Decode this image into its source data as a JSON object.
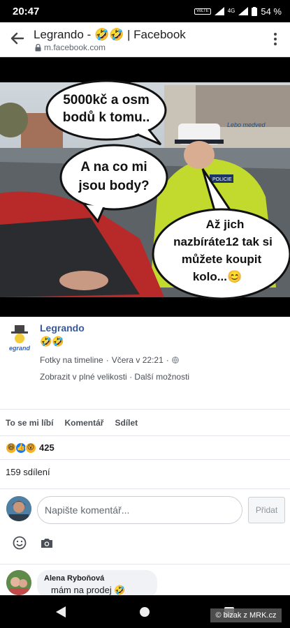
{
  "status": {
    "time": "20:47",
    "volte": "VoLTE",
    "network": "4G",
    "battery": "54 %"
  },
  "browser": {
    "title": "Legrando - 🤣🤣 | Facebook",
    "host": "m.facebook.com",
    "icons": {
      "back": "arrow-left-icon",
      "lock": "lock-icon",
      "menu": "more-vertical-icon"
    }
  },
  "meme": {
    "bubble1": [
      "5000kč a osm",
      "bodů k tomu.."
    ],
    "bubble2": [
      "A na co mi",
      "jsou body?"
    ],
    "bubble3": [
      "Až jich",
      "nazbíráte12 tak si",
      "můžete koupit",
      "kolo...😊"
    ],
    "signature": "Lebo medved",
    "vest_text": "POLICIE"
  },
  "post": {
    "author": "Legrando",
    "emojis": "🤣🤣",
    "logo_text": "egrand",
    "album": "Fotky na timeline",
    "time": "Včera v 22:21",
    "full_size": "Zobrazit v plné velikosti",
    "more_options": "Další možnosti"
  },
  "actions": {
    "like": "To se mi líbí",
    "comment": "Komentář",
    "share": "Sdílet"
  },
  "reactions": {
    "icons": [
      "haha-icon",
      "like-icon",
      "wow-icon"
    ],
    "count": "425"
  },
  "shares": "159 sdílení",
  "composer": {
    "placeholder": "Napište komentář...",
    "post_label": "Přidat",
    "icons": [
      "emoji-icon",
      "camera-icon"
    ]
  },
  "comment": {
    "name": "Alena Ryboňová",
    "text": "mám na prodej 🤣"
  },
  "watermark": "© bizak z MRK.cz"
}
